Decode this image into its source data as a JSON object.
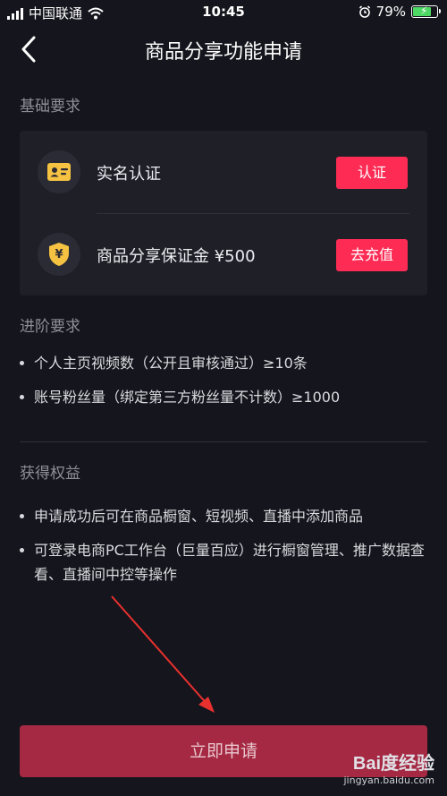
{
  "status_bar": {
    "carrier": "中国联通",
    "time": "10:45",
    "battery": "79%",
    "battery_level": 0.79
  },
  "nav": {
    "title": "商品分享功能申请"
  },
  "basic": {
    "title": "基础要求",
    "items": [
      {
        "label": "实名认证",
        "button": "认证",
        "icon": "id-card-icon"
      },
      {
        "label": "商品分享保证金 ¥500",
        "button": "去充值",
        "icon": "yuan-shield-icon"
      }
    ]
  },
  "advanced": {
    "title": "进阶要求",
    "items": [
      "个人主页视频数（公开且审核通过）≥10条",
      "账号粉丝量（绑定第三方粉丝量不计数）≥1000"
    ]
  },
  "benefits": {
    "title": "获得权益",
    "items": [
      "申请成功后可在商品橱窗、短视频、直播中添加商品",
      "可登录电商PC工作台（巨量百应）进行橱窗管理、推广数据查看、直播间中控等操作"
    ]
  },
  "apply_button": "立即申请",
  "watermark": {
    "brand": "Bai度经验",
    "sub": "jingyan.baidu.com"
  },
  "colors": {
    "accent": "#fe2c55",
    "apply_bg": "#a52943",
    "background": "#15151d",
    "card": "#1f1f28",
    "icon_gold": "#f5c242",
    "arrow": "#e8312e"
  }
}
